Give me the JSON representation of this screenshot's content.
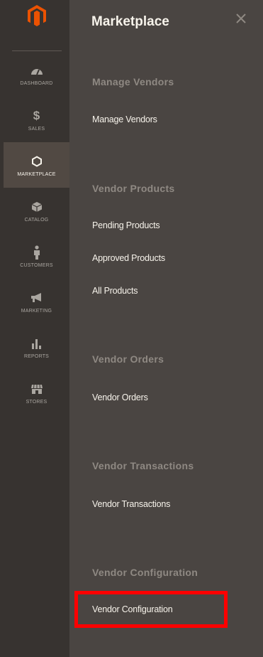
{
  "sidebar": {
    "logo": "magento-logo-icon",
    "items": [
      {
        "label": "DASHBOARD",
        "icon": "speedometer-icon",
        "active": false
      },
      {
        "label": "SALES",
        "icon": "dollar-icon",
        "active": false
      },
      {
        "label": "MARKETPLACE",
        "icon": "hexagon-icon",
        "active": true
      },
      {
        "label": "CATALOG",
        "icon": "box-icon",
        "active": false
      },
      {
        "label": "CUSTOMERS",
        "icon": "person-icon",
        "active": false
      },
      {
        "label": "MARKETING",
        "icon": "megaphone-icon",
        "active": false
      },
      {
        "label": "REPORTS",
        "icon": "bar-chart-icon",
        "active": false
      },
      {
        "label": "STORES",
        "icon": "storefront-icon",
        "active": false
      }
    ]
  },
  "panel": {
    "title": "Marketplace",
    "close_icon": "close-icon",
    "sections": [
      {
        "heading": "Manage Vendors",
        "links": [
          "Manage Vendors"
        ]
      },
      {
        "heading": "Vendor Products",
        "links": [
          "Pending Products",
          "Approved Products",
          "All Products"
        ]
      },
      {
        "heading": "Vendor Orders",
        "links": [
          "Vendor Orders"
        ]
      },
      {
        "heading": "Vendor Transactions",
        "links": [
          "Vendor Transactions"
        ]
      },
      {
        "heading": "Vendor Configuration",
        "links": [
          "Vendor Configuration"
        ]
      }
    ]
  },
  "colors": {
    "sidebar_bg": "#373330",
    "panel_bg": "#4a4542",
    "active_bg": "#514943",
    "highlight": "#ff0000",
    "logo_orange": "#eb5202"
  }
}
